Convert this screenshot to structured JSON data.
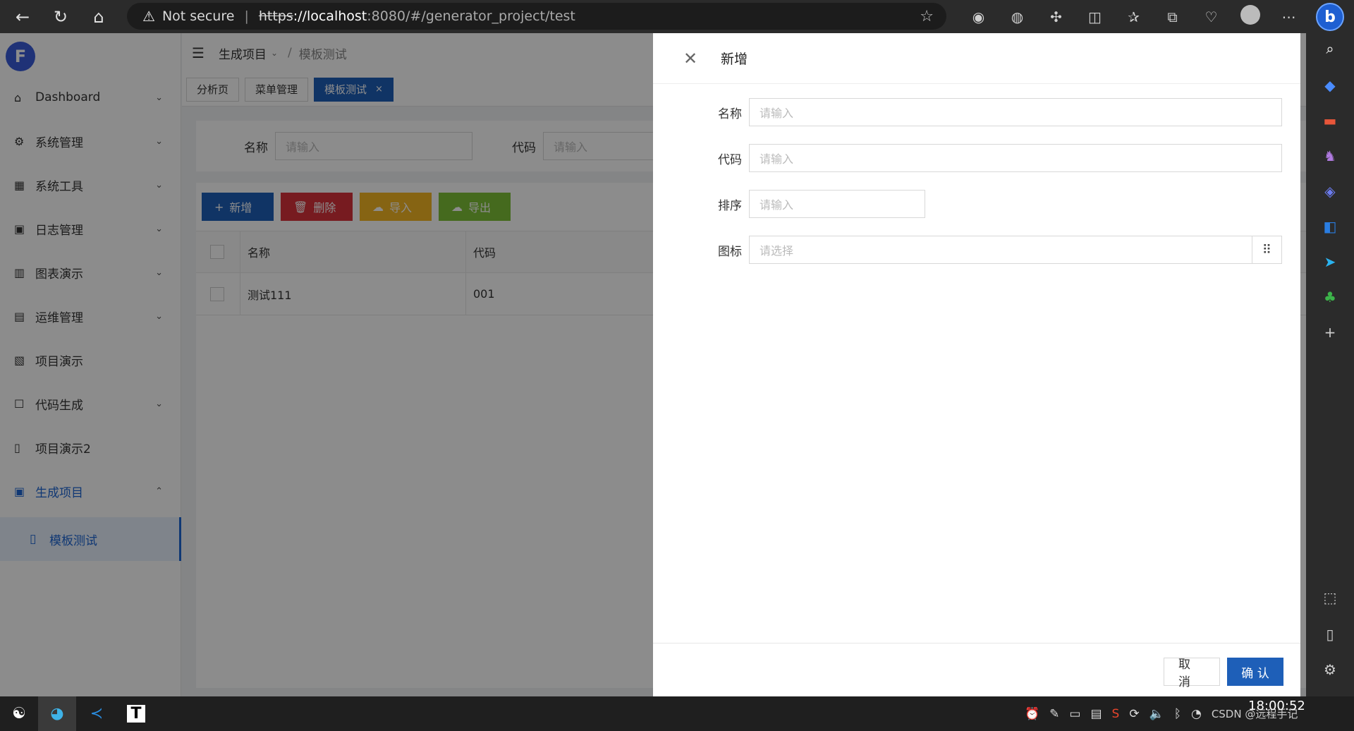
{
  "browser": {
    "security_label": "Not secure",
    "url_scheme": "https",
    "url_host": "://localhost",
    "url_path": ":8080/#/generator_project/test"
  },
  "sidebar": {
    "logo": "F",
    "items": [
      {
        "label": "Dashboard",
        "icon": "⌂",
        "chevron": "⌄"
      },
      {
        "label": "系统管理",
        "icon": "⚙",
        "chevron": "⌄"
      },
      {
        "label": "系统工具",
        "icon": "▦",
        "chevron": "⌄"
      },
      {
        "label": "日志管理",
        "icon": "▣",
        "chevron": "⌄"
      },
      {
        "label": "图表演示",
        "icon": "▥",
        "chevron": "⌄"
      },
      {
        "label": "运维管理",
        "icon": "▤",
        "chevron": "⌄"
      },
      {
        "label": "项目演示",
        "icon": "▧",
        "chevron": ""
      },
      {
        "label": "代码生成",
        "icon": "☐",
        "chevron": "⌄"
      },
      {
        "label": "项目演示2",
        "icon": "▯",
        "chevron": ""
      },
      {
        "label": "生成项目",
        "icon": "▣",
        "chevron": "⌃"
      }
    ],
    "sub_item": {
      "label": "模板测试",
      "icon": "▯"
    }
  },
  "topbar": {
    "crumb1": "生成项目",
    "crumb_sep": "/",
    "crumb2": "模板测试"
  },
  "tabs": [
    {
      "label": "分析页"
    },
    {
      "label": "菜单管理"
    },
    {
      "label": "模板测试",
      "close": "×"
    }
  ],
  "search": {
    "name_label": "名称",
    "name_placeholder": "请输入",
    "code_label": "代码",
    "code_placeholder": "请输入"
  },
  "toolbar": {
    "add": "新增",
    "delete": "删除",
    "import": "导入",
    "export": "导出"
  },
  "table": {
    "columns": [
      "名称",
      "代码"
    ],
    "rows": [
      {
        "name": "测试111",
        "code": "001"
      }
    ]
  },
  "drawer": {
    "title": "新增",
    "fields": {
      "name_label": "名称",
      "name_placeholder": "请输入",
      "code_label": "代码",
      "code_placeholder": "请输入",
      "sort_label": "排序",
      "sort_placeholder": "请输入",
      "icon_label": "图标",
      "icon_placeholder": "请选择"
    },
    "cancel": "取 消",
    "confirm": "确 认"
  },
  "taskbar": {
    "clock_time": "18:00:52",
    "watermark": "CSDN @远程手记"
  }
}
